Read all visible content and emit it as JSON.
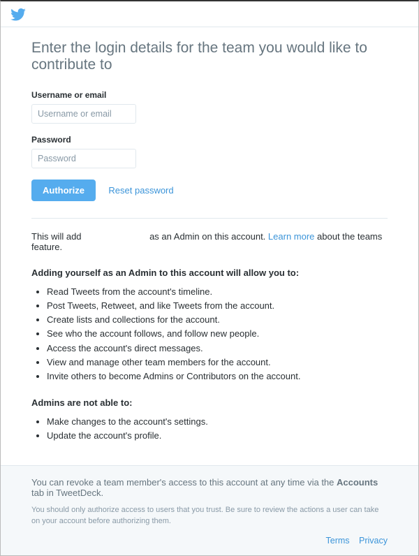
{
  "heading": "Enter the login details for the team you would like to contribute to",
  "form": {
    "username_label": "Username or email",
    "username_placeholder": "Username or email",
    "password_label": "Password",
    "password_placeholder": "Password",
    "authorize_label": "Authorize",
    "reset_password_label": "Reset password"
  },
  "info": {
    "prefix": "This will add",
    "suffix": "as an Admin on this account.",
    "learn_more_label": "Learn more",
    "after_link": "about the teams feature."
  },
  "allow_title": "Adding yourself as an Admin to this account will allow you to:",
  "allow": [
    "Read Tweets from the account's timeline.",
    "Post Tweets, Retweet, and like Tweets from the account.",
    "Create lists and collections for the account.",
    "See who the account follows, and follow new people.",
    "Access the account's direct messages.",
    "View and manage other team members for the account.",
    "Invite others to become Admins or Contributors on the account."
  ],
  "deny_title": "Admins are not able to:",
  "deny": [
    "Make changes to the account's settings.",
    "Update the account's profile."
  ],
  "footer": {
    "revoke_prefix": "You can revoke a team member's access to this account at any time via the ",
    "revoke_bold": "Accounts",
    "revoke_suffix": " tab in TweetDeck.",
    "warning": "You should only authorize access to users that you trust. Be sure to review the actions a user can take on your account before authorizing them.",
    "terms_label": "Terms",
    "privacy_label": "Privacy"
  }
}
